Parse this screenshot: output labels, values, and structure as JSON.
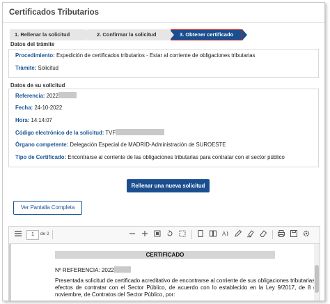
{
  "page_title": "Certificados Tributarios",
  "steps": [
    {
      "label": "1. Rellenar la solicitud"
    },
    {
      "label": "2. Confirmar la solicitud"
    },
    {
      "label": "3. Obtener certificado"
    }
  ],
  "tramite": {
    "heading": "Datos del trámite",
    "procedimiento_label": "Procedimiento:",
    "procedimiento_value": "Expedición de certificados tributarios - Estar al corriente de obligaciones tributarias",
    "tramite_label": "Trámite:",
    "tramite_value": "Solicitud"
  },
  "solicitud": {
    "heading": "Datos de su solicitud",
    "referencia_label": "Referencia:",
    "referencia_value": "2022",
    "fecha_label": "Fecha:",
    "fecha_value": "24-10-2022",
    "hora_label": "Hora:",
    "hora_value": "14:14:07",
    "codigo_label": "Código electrónico de la solicitud:",
    "codigo_value": "TVF",
    "organo_label": "Órgano competente:",
    "organo_value": "Delegación Especial de MADRID-Administración de SUROESTE",
    "tipo_label": "Tipo de Certificado:",
    "tipo_value": "Encontrarse al corriente de las obligaciones tributarias para contratar con el sector público"
  },
  "buttons": {
    "new_request": "Rellenar una nueva solicitud",
    "full_screen": "Ver Pantalla Completa"
  },
  "viewer": {
    "page_current": "1",
    "page_total": "de 2"
  },
  "document": {
    "title": "CERTIFICADO",
    "ref_line": "Nº REFERENCIA: 2022",
    "paragraph": "Presentada solicitud de certificado acreditativo de encontrarse al corriente de sus obligaciones tributarias a efectos de contratar con el Sector Público, de acuerdo con lo establecido en la Ley 9/2017, de 8 de noviembre, de Contratos del Sector Público, por:"
  }
}
